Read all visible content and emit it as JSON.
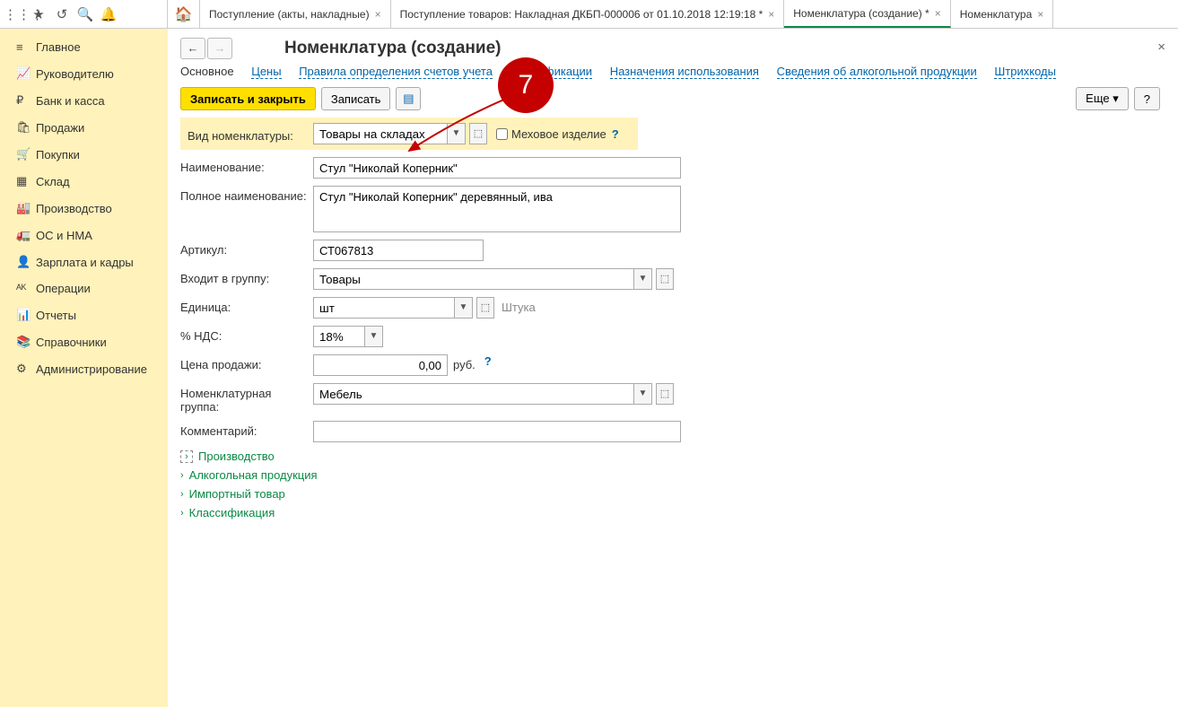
{
  "tabs": [
    {
      "label": "Поступление (акты, накладные)"
    },
    {
      "label": "Поступление товаров: Накладная ДКБП-000006 от 01.10.2018 12:19:18 *"
    },
    {
      "label": "Номенклатура (создание) *",
      "active": true
    },
    {
      "label": "Номенклатура"
    }
  ],
  "sidebar": [
    {
      "icon": "≡",
      "label": "Главное"
    },
    {
      "icon": "📈",
      "label": "Руководителю"
    },
    {
      "icon": "₽",
      "label": "Банк и касса"
    },
    {
      "icon": "🛍",
      "label": "Продажи"
    },
    {
      "icon": "🛒",
      "label": "Покупки"
    },
    {
      "icon": "▦",
      "label": "Склад"
    },
    {
      "icon": "🏭",
      "label": "Производство"
    },
    {
      "icon": "🚛",
      "label": "ОС и НМА"
    },
    {
      "icon": "👤",
      "label": "Зарплата и кадры"
    },
    {
      "icon": "ᴬᴷ",
      "label": "Операции"
    },
    {
      "icon": "📊",
      "label": "Отчеты"
    },
    {
      "icon": "📚",
      "label": "Справочники"
    },
    {
      "icon": "⚙",
      "label": "Администрирование"
    }
  ],
  "page": {
    "title": "Номенклатура (создание)",
    "badge": "7",
    "subtabs": [
      "Основное",
      "Цены",
      "Правила определения счетов учета",
      "Спецификации",
      "Назначения использования",
      "Сведения об алкогольной продукции",
      "Штрихкоды"
    ],
    "buttons": {
      "save_close": "Записать и закрыть",
      "save": "Записать",
      "more": "Еще",
      "help": "?"
    },
    "fields": {
      "kind_label": "Вид номенклатуры:",
      "kind_value": "Товары на складах",
      "fur_label": "Меховое изделие",
      "name_label": "Наименование:",
      "name_value": "Стул \"Николай Коперник\"",
      "fullname_label": "Полное наименование:",
      "fullname_value": "Стул \"Николай Коперник\" деревянный, ива",
      "sku_label": "Артикул:",
      "sku_value": "СТ067813",
      "group_label": "Входит в группу:",
      "group_value": "Товары",
      "unit_label": "Единица:",
      "unit_value": "шт",
      "unit_hint": "Штука",
      "vat_label": "% НДС:",
      "vat_value": "18%",
      "price_label": "Цена продажи:",
      "price_value": "0,00",
      "price_cur": "руб.",
      "nomgroup_label": "Номенклатурная группа:",
      "nomgroup_value": "Мебель",
      "comment_label": "Комментарий:",
      "comment_value": ""
    },
    "sections": [
      "Производство",
      "Алкогольная продукция",
      "Импортный товар",
      "Классификация"
    ]
  }
}
